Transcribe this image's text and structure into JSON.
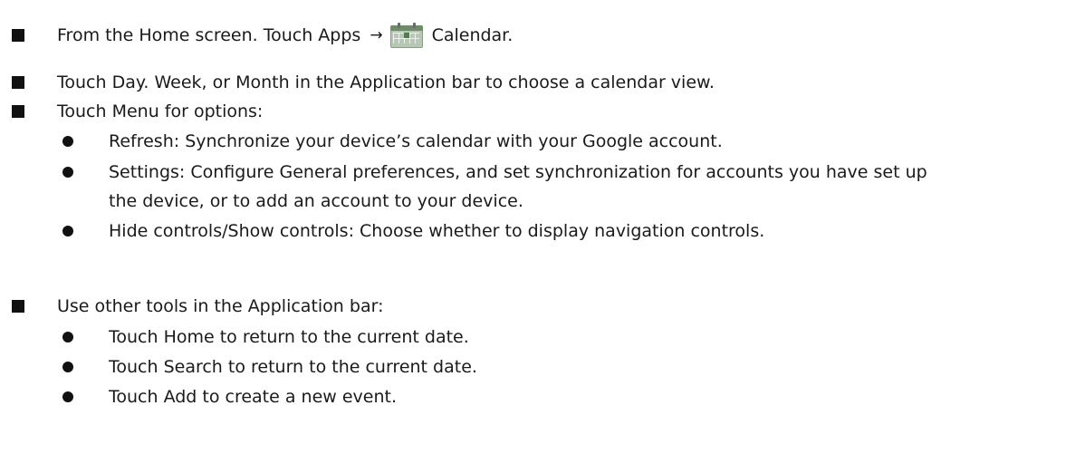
{
  "steps": [
    {
      "text_before_arrow": "From the Home screen. Touch Apps",
      "arrow": "→",
      "icon": "calendar-app-icon",
      "text_after_icon": "Calendar."
    },
    {
      "text": "Touch Day. Week, or Month in the Application bar to choose a calendar view."
    },
    {
      "text": "Touch Menu for options:",
      "options": [
        "Refresh: Synchronize your device’s calendar with your Google account.",
        "Settings: Configure General preferences, and set synchronization for accounts you have set up",
        "the device, or to add an account to your device.",
        "Hide controls/Show controls: Choose whether to display navigation controls."
      ]
    },
    {
      "text": "Use other tools in the Application bar:",
      "options": [
        "Touch Home to return to the current date.",
        "Touch Search to return to the current date.",
        "Touch Add to create a new event."
      ]
    }
  ]
}
